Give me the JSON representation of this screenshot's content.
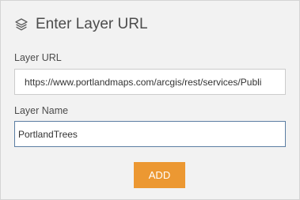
{
  "header": {
    "icon": "layers-icon",
    "title": "Enter Layer URL"
  },
  "form": {
    "url_label": "Layer URL",
    "url_value": "https://www.portlandmaps.com/arcgis/rest/services/Publi",
    "name_label": "Layer Name",
    "name_value": "PortlandTrees"
  },
  "actions": {
    "add_label": "ADD"
  },
  "colors": {
    "panel_background": "#f2f2f2",
    "add_button": "#ec9832",
    "focused_border": "#5c7ea3",
    "text": "#4c4c4c"
  }
}
